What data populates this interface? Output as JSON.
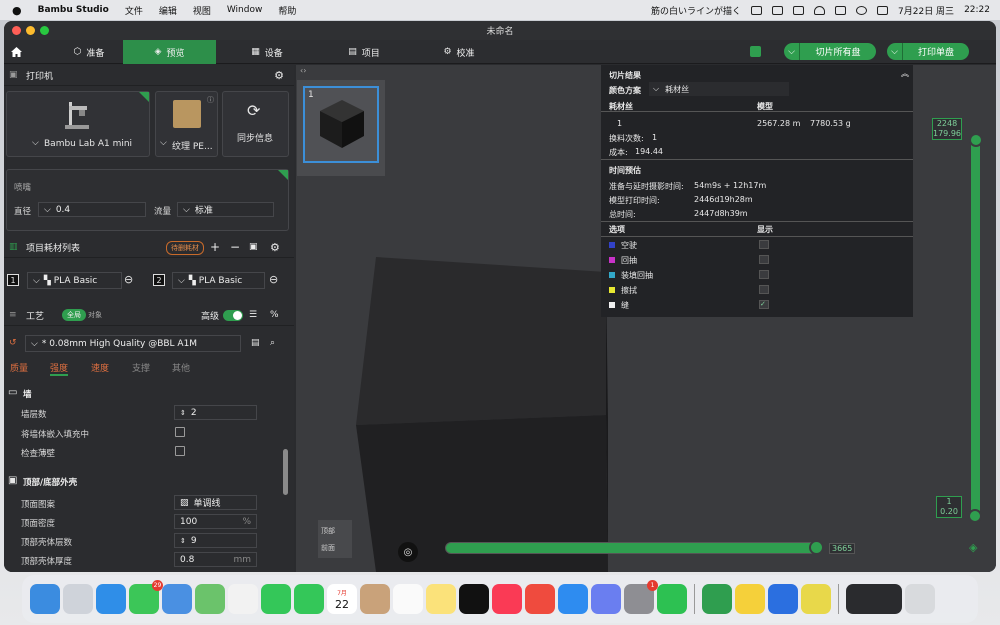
{
  "menubar": {
    "app": "Bambu Studio",
    "items": [
      "文件",
      "编辑",
      "视图",
      "Window",
      "帮助"
    ],
    "notification": "筋の白いラインが描く",
    "date": "7月22日 周三",
    "time": "22:22"
  },
  "window": {
    "title": "未命名"
  },
  "nav": {
    "tabs": [
      "准备",
      "预览",
      "设备",
      "项目",
      "校准"
    ],
    "active": "预览",
    "slice_all": "切片所有盘",
    "print_plate": "打印单盘"
  },
  "printer": {
    "header": "打印机",
    "model": "Bambu Lab A1 mini",
    "plate": "纹理 PE...",
    "sync": "同步信息"
  },
  "nozzle": {
    "label": "喷嘴",
    "diameter_label": "直径",
    "diameter": "0.4",
    "flow_label": "流量",
    "flow": "标准"
  },
  "filament": {
    "header": "项目耗材列表",
    "tag": "待删耗材",
    "slots": [
      {
        "num": "1",
        "type": "PLA Basic"
      },
      {
        "num": "2",
        "type": "PLA Basic"
      }
    ]
  },
  "process": {
    "header": "工艺",
    "global": "全局",
    "object": "对象",
    "advanced": "高级",
    "preset": "* 0.08mm High Quality @BBL A1M",
    "tabs": [
      "质量",
      "强度",
      "速度",
      "支撑",
      "其他"
    ],
    "active_tab": "强度"
  },
  "wall": {
    "title": "墙",
    "loops_label": "墙层数",
    "loops": "2",
    "embed_label": "将墙体嵌入填充中",
    "detect_label": "检查薄壁"
  },
  "shell": {
    "title": "顶部/底部外壳",
    "pattern_label": "顶面图案",
    "pattern": "单调线",
    "density_label": "顶面密度",
    "density": "100",
    "density_unit": "%",
    "layers_label": "顶部壳体层数",
    "layers": "9",
    "thickness_label": "顶部壳体厚度",
    "thickness": "0.8",
    "thickness_unit": "mm"
  },
  "viewport": {
    "plate_number": "1",
    "slider_top": "2248",
    "slider_top2": "179.96",
    "slider_bottom": "1",
    "slider_bottom2": "0.20",
    "hslider_value": "3665",
    "cube_top": "顶部",
    "cube_front": "前面"
  },
  "slice": {
    "title": "切片结果",
    "color_scheme_label": "颜色方案",
    "color_scheme": "耗材丝",
    "col_filament": "耗材丝",
    "col_model": "模型",
    "row_id": "1",
    "length": "2567.28 m",
    "weight": "7780.53 g",
    "changes_label": "换料次数:",
    "changes": "1",
    "cost_label": "成本:",
    "cost": "194.44",
    "time_title": "时间预估",
    "prep_label": "准备与延时摄影时间:",
    "prep": "54m9s + 12h17m",
    "model_label": "模型打印时间:",
    "model_time": "2446d19h28m",
    "total_label": "总时间:",
    "total": "2447d8h39m",
    "options_label": "选项",
    "display_label": "显示",
    "options": [
      {
        "name": "空驶",
        "color": "#3242c8"
      },
      {
        "name": "回抽",
        "color": "#c832c8"
      },
      {
        "name": "装填回抽",
        "color": "#32a8c8"
      },
      {
        "name": "擦拭",
        "color": "#e8e832"
      },
      {
        "name": "缝",
        "color": "#f0f0f0"
      }
    ]
  },
  "dock": {
    "calendar_day": "22",
    "calendar_month": "7月",
    "messages_badge": "29",
    "settings_badge": "1"
  }
}
